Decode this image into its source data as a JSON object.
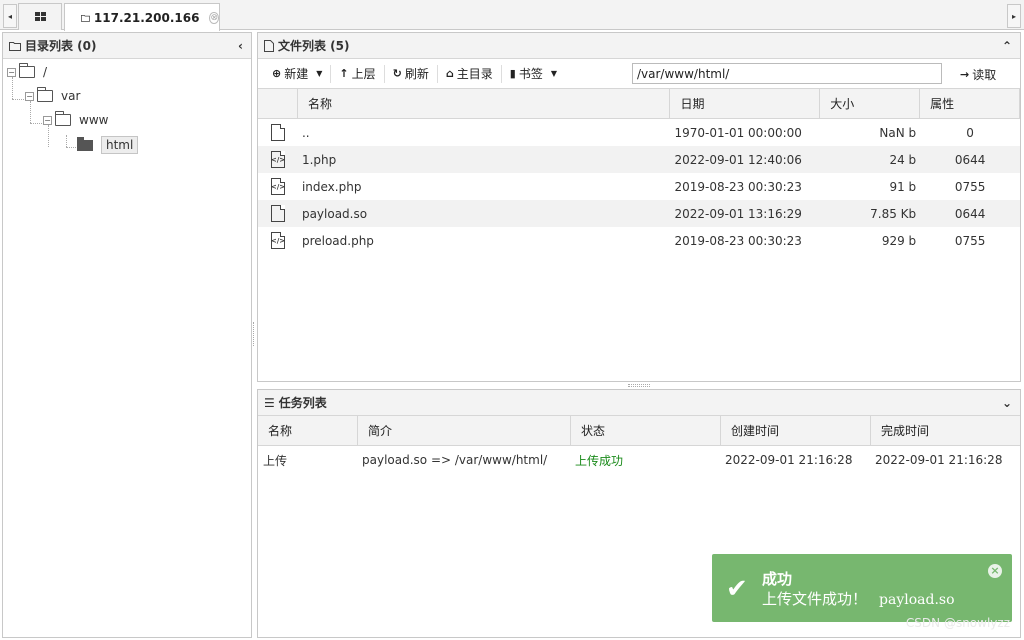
{
  "tabbar": {
    "left_arrow": "◂",
    "right_arrow": "▸",
    "home_icon": "grid-icon",
    "active_tab": "117.21.200.166",
    "close_icon": "⊗"
  },
  "dir_panel": {
    "title": "目录列表 (0)",
    "collapse": "‹",
    "tree": [
      {
        "label": "/"
      },
      {
        "label": "var"
      },
      {
        "label": "www"
      },
      {
        "label": "html"
      }
    ]
  },
  "file_panel": {
    "title": "文件列表 (5)",
    "collapse": "⌃",
    "toolbar": {
      "new": "新建",
      "up": "上层",
      "refresh": "刷新",
      "home": "主目录",
      "bookmark": "书签",
      "path": "/var/www/html/",
      "read": "读取"
    },
    "columns": {
      "name": "名称",
      "date": "日期",
      "size": "大小",
      "attr": "属性"
    },
    "rows": [
      {
        "icon": "file",
        "name": "..",
        "date": "1970-01-01 00:00:00",
        "size": "NaN b",
        "attr": "0"
      },
      {
        "icon": "code",
        "name": "1.php",
        "date": "2022-09-01 12:40:06",
        "size": "24 b",
        "attr": "0644"
      },
      {
        "icon": "code",
        "name": "index.php",
        "date": "2019-08-23 00:30:23",
        "size": "91 b",
        "attr": "0755"
      },
      {
        "icon": "file",
        "name": "payload.so",
        "date": "2022-09-01 13:16:29",
        "size": "7.85 Kb",
        "attr": "0644"
      },
      {
        "icon": "code",
        "name": "preload.php",
        "date": "2019-08-23 00:30:23",
        "size": "929 b",
        "attr": "0755"
      }
    ]
  },
  "task_panel": {
    "title": "任务列表",
    "collapse": "⌄",
    "columns": {
      "name": "名称",
      "desc": "简介",
      "status": "状态",
      "created": "创建时间",
      "done": "完成时间"
    },
    "rows": [
      {
        "name": "上传",
        "desc": "payload.so => /var/www/html/",
        "status": "上传成功",
        "created": "2022-09-01 21:16:28",
        "done": "2022-09-01 21:16:28"
      }
    ]
  },
  "toast": {
    "title": "成功",
    "message": "上传文件成功！",
    "file": "payload.so",
    "close": "×"
  },
  "watermark": "CSDN @snowlyzz",
  "colors": {
    "toast_bg": "#77b76f",
    "success_text": "#1a8a1a"
  }
}
